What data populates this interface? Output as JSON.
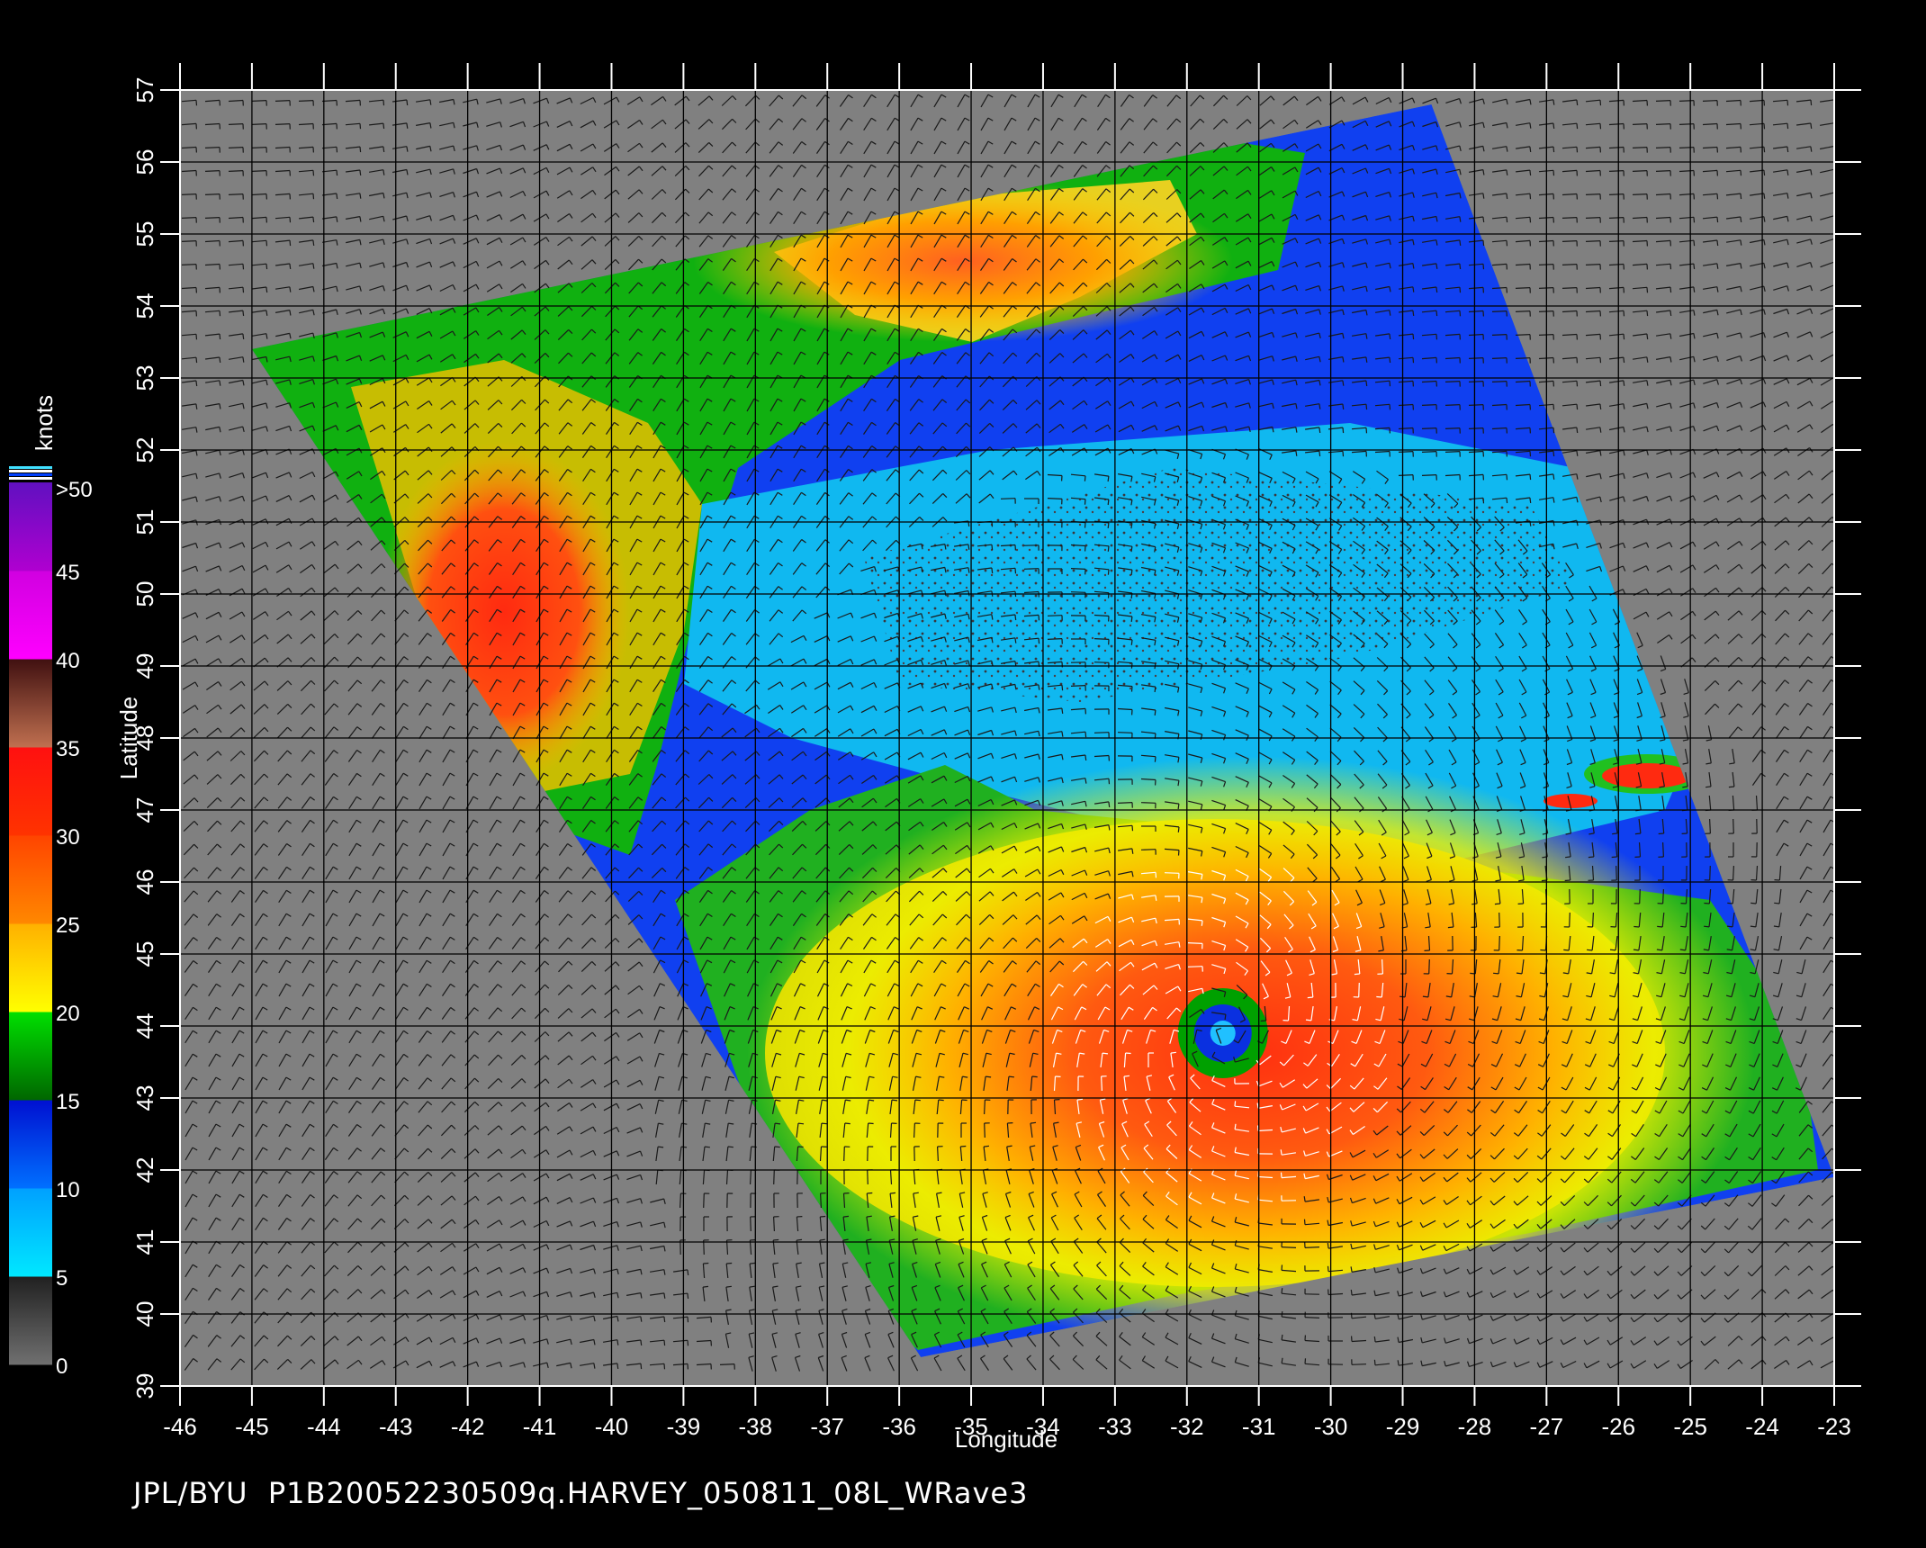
{
  "map": {
    "xlabel": "Longitude",
    "ylabel": "Latitude",
    "lon_range": [
      -46,
      -23
    ],
    "lat_range": [
      39,
      57
    ],
    "lon_ticks": [
      "-46",
      "-45",
      "-44",
      "-43",
      "-42",
      "-41",
      "-40",
      "-39",
      "-38",
      "-37",
      "-36",
      "-35",
      "-34",
      "-33",
      "-32",
      "-31",
      "-30",
      "-29",
      "-28",
      "-27",
      "-26",
      "-25",
      "-24",
      "-23"
    ],
    "lat_ticks": [
      "39",
      "40",
      "41",
      "42",
      "43",
      "44",
      "45",
      "46",
      "47",
      "48",
      "49",
      "50",
      "51",
      "52",
      "53",
      "54",
      "55",
      "56",
      "57"
    ],
    "background_color": "#808080",
    "swath_corners_lonlat": [
      [
        -45.0,
        53.4
      ],
      [
        -28.6,
        56.8
      ],
      [
        -23.0,
        41.9
      ],
      [
        -35.7,
        39.4
      ]
    ],
    "storm_eye_lonlat": [
      -31.5,
      43.9
    ]
  },
  "colorbar": {
    "unit": "knots",
    "labels": [
      ">50",
      "45",
      "40",
      "35",
      "30",
      "25",
      "20",
      "15",
      "10",
      "5",
      "0"
    ],
    "bands": [
      {
        "from": 0,
        "to": 5,
        "colors": [
          "#707070",
          "#202020"
        ]
      },
      {
        "from": 5,
        "to": 10,
        "colors": [
          "#00e8ff",
          "#00a0ff"
        ]
      },
      {
        "from": 10,
        "to": 15,
        "colors": [
          "#0070ff",
          "#0010d0"
        ]
      },
      {
        "from": 15,
        "to": 20,
        "colors": [
          "#006600",
          "#00e000"
        ]
      },
      {
        "from": 20,
        "to": 25,
        "colors": [
          "#ffff00",
          "#ffb000"
        ]
      },
      {
        "from": 25,
        "to": 30,
        "colors": [
          "#ff8800",
          "#ff4400"
        ]
      },
      {
        "from": 30,
        "to": 35,
        "colors": [
          "#ff3300",
          "#ff1010"
        ]
      },
      {
        "from": 35,
        "to": 40,
        "colors": [
          "#c07050",
          "#401010"
        ]
      },
      {
        "from": 40,
        "to": 45,
        "colors": [
          "#ff00ff",
          "#d000e0"
        ]
      },
      {
        "from": 45,
        "to": 50,
        "colors": [
          "#b000d0",
          "#6010c0"
        ]
      }
    ]
  },
  "footer_text": "JPL/BYU  P1B20052230509q.HARVEY_050811_08L_WRave3"
}
